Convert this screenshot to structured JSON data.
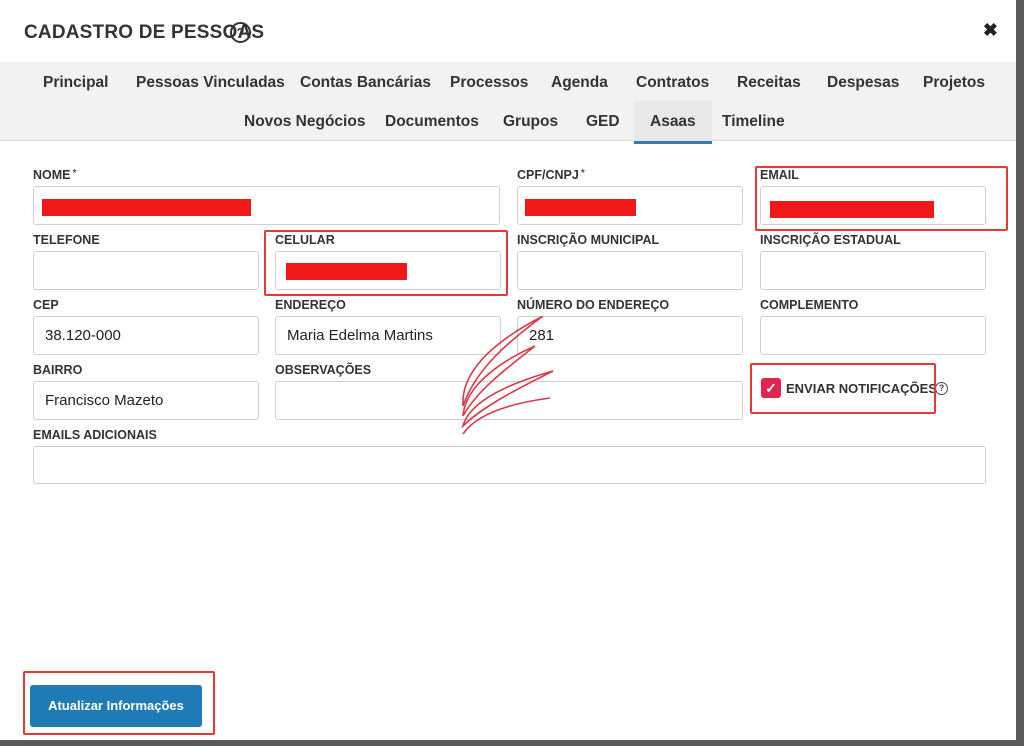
{
  "modal": {
    "title": "CADASTRO DE PESSOAS",
    "help_icon": "question-circle-icon",
    "close_icon": "close-x-icon"
  },
  "tabs": {
    "row1": [
      "Principal",
      "Pessoas Vinculadas",
      "Contas Bancárias",
      "Processos",
      "Agenda",
      "Contratos",
      "Receitas",
      "Despesas",
      "Projetos"
    ],
    "row2": [
      "Novos Negócios",
      "Documentos",
      "Grupos",
      "GED",
      "Asaas",
      "Timeline"
    ],
    "active": "Asaas"
  },
  "form": {
    "nome": {
      "label": "NOME",
      "required_mark": "*",
      "value": ""
    },
    "cpf_cnpj": {
      "label": "CPF/CNPJ",
      "required_mark": "*",
      "value": ""
    },
    "email": {
      "label": "EMAIL",
      "value": ""
    },
    "telefone": {
      "label": "TELEFONE",
      "value": ""
    },
    "celular": {
      "label": "CELULAR",
      "value": ""
    },
    "inscricao_municipal": {
      "label": "INSCRIÇÃO MUNICIPAL",
      "value": ""
    },
    "inscricao_estadual": {
      "label": "INSCRIÇÃO ESTADUAL",
      "value": ""
    },
    "cep": {
      "label": "CEP",
      "value": "38.120-000"
    },
    "endereco": {
      "label": "ENDEREÇO",
      "value": "Maria Edelma Martins"
    },
    "numero": {
      "label": "NÚMERO DO ENDEREÇO",
      "value": "281"
    },
    "complemento": {
      "label": "COMPLEMENTO",
      "value": ""
    },
    "bairro": {
      "label": "BAIRRO",
      "value": "Francisco Mazeto"
    },
    "observacoes": {
      "label": "OBSERVAÇÕES",
      "value": ""
    },
    "enviar_notificacoes": {
      "label": "ENVIAR NOTIFICAÇÕES",
      "checked": true
    },
    "emails_adicionais": {
      "label": "EMAILS ADICIONAIS",
      "value": ""
    }
  },
  "actions": {
    "update_label": "Atualizar Informações"
  },
  "colors": {
    "accent": "#1f7bb5",
    "highlight": "#e53935",
    "redaction": "#f01818",
    "checkbox": "#e0244f"
  }
}
